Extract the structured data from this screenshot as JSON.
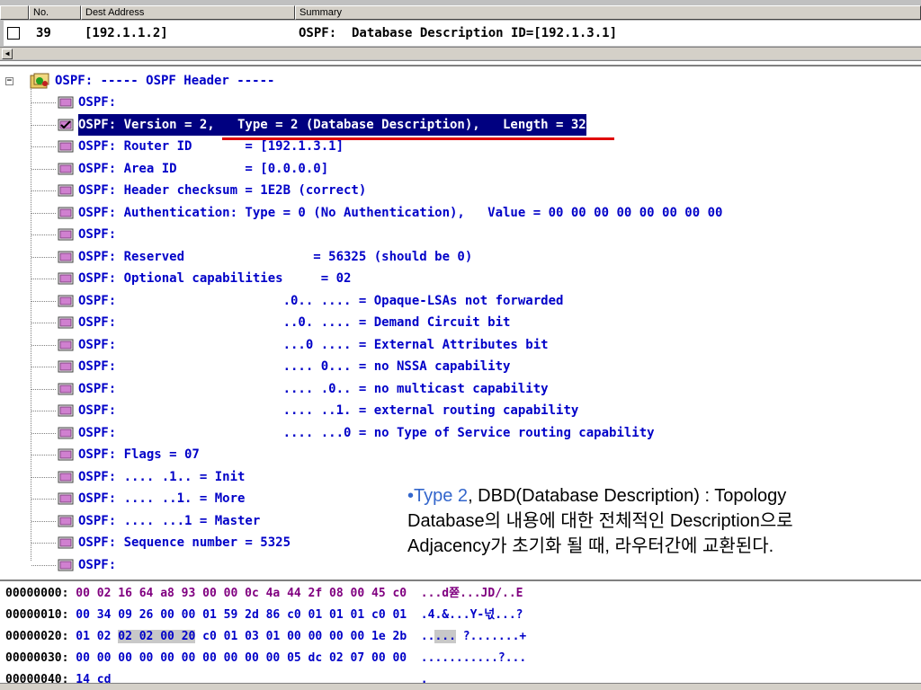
{
  "packet_list": {
    "columns": [
      "No.",
      "Dest Address",
      "Summary"
    ],
    "row": {
      "no": "39",
      "dest": "[192.1.1.2]",
      "summary": "OSPF:  Database Description ID=[192.1.3.1]"
    }
  },
  "detail": {
    "root": "OSPF: ----- OSPF Header -----",
    "lines": [
      "OSPF:",
      "OSPF: Version = 2,   Type = 2 (Database Description),   Length = 32",
      "OSPF: Router ID       = [192.1.3.1]",
      "OSPF: Area ID         = [0.0.0.0]",
      "OSPF: Header checksum = 1E2B (correct)",
      "OSPF: Authentication: Type = 0 (No Authentication),   Value = 00 00 00 00 00 00 00 00",
      "OSPF:",
      "OSPF: Reserved                 = 56325 (should be 0)",
      "OSPF: Optional capabilities     = 02",
      "OSPF:                      .0.. .... = Opaque-LSAs not forwarded",
      "OSPF:                      ..0. .... = Demand Circuit bit",
      "OSPF:                      ...0 .... = External Attributes bit",
      "OSPF:                      .... 0... = no NSSA capability",
      "OSPF:                      .... .0.. = no multicast capability",
      "OSPF:                      .... ..1. = external routing capability",
      "OSPF:                      .... ...0 = no Type of Service routing capability",
      "OSPF: Flags = 07",
      "OSPF: .... .1.. = Init",
      "OSPF: .... ..1. = More",
      "OSPF: .... ...1 = Master",
      "OSPF: Sequence number = 5325",
      "OSPF:"
    ],
    "selected_index": 1
  },
  "annotation": {
    "bullet": "•",
    "line1_highlight": "Type 2",
    "line1_rest": ", DBD(Database Description) : Topology",
    "line2": "Database의 내용에 대한 전체적인 Description으로",
    "line3": "Adjacency가 초기화 될 때, 라우터간에 교환된다."
  },
  "hex": [
    {
      "offset": "00000000:",
      "pre": "",
      "sel": "",
      "bytes": "00 02 16 64 a8 93 00 00 0c 4a 44 2f 08 00 45 c0",
      "ascii": "...d쮿...JD/..E",
      "purple": true
    },
    {
      "offset": "00000010:",
      "pre": "",
      "sel": "",
      "bytes": "00 34 09 26 00 00 01 59 2d 86 c0 01 01 01 c0 01",
      "ascii": ".4.&...Y-넋...?",
      "purple": false
    },
    {
      "offset": "00000020:",
      "pre": "01 02 ",
      "sel": "02 02 00 20",
      "bytes": " c0 01 03 01 00 00 00 00 1e 2b",
      "ascii_pre": "..",
      "ascii_sel": "...",
      "ascii": " ?.......+",
      "purple": false
    },
    {
      "offset": "00000030:",
      "pre": "",
      "sel": "",
      "bytes": "00 00 00 00 00 00 00 00 00 00 05 dc 02 07 00 00",
      "ascii": "...........?...",
      "purple": false
    },
    {
      "offset": "00000040:",
      "pre": "",
      "sel": "",
      "bytes": "14 cd",
      "ascii": ".",
      "purple": false
    }
  ]
}
